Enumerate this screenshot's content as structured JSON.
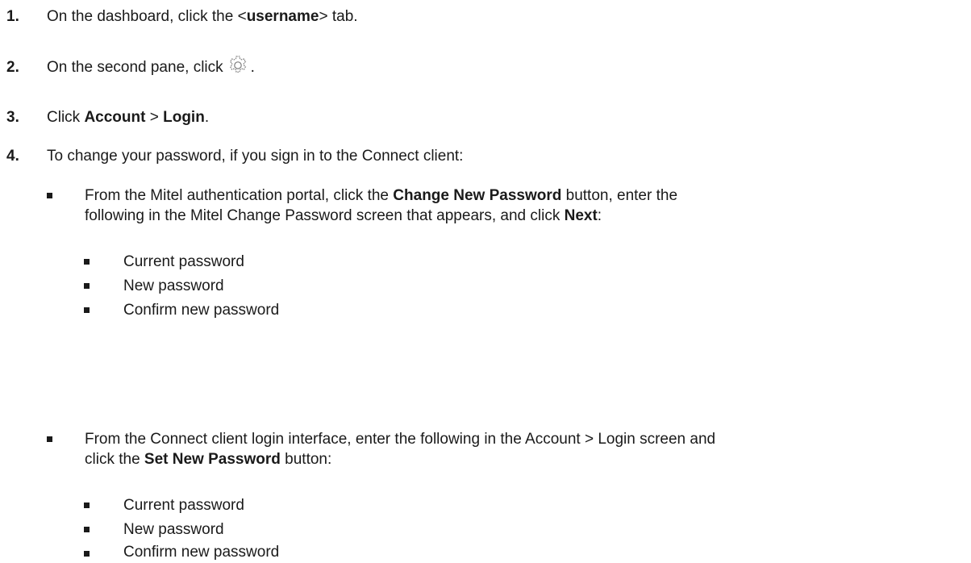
{
  "steps": [
    {
      "num": "1.",
      "pre": "On the dashboard, click the <",
      "bold": "username",
      "post": "> tab."
    },
    {
      "num": "2.",
      "pre": "On the second pane, click",
      "post": "."
    },
    {
      "num": "3.",
      "pre": "Click ",
      "bold1": "Account",
      "mid": " > ",
      "bold2": "Login",
      "post": "."
    },
    {
      "num": "4.",
      "text": "To change your password, if you sign in to the Connect client:"
    }
  ],
  "option_portal": {
    "pre": "From the Mitel authentication portal, click the ",
    "bold": "Change New Password",
    "post": " button, enter the",
    "line2_pre": "following in the Mitel Change Password screen that appears, and click ",
    "line2_bold": "Next",
    "line2_post": ":",
    "items": [
      "Current password",
      "New password",
      "Confirm new password"
    ]
  },
  "option_client": {
    "line1": "From the Connect client login interface, enter the following in the Account > Login screen and",
    "line2_pre": "click the ",
    "line2_bold": "Set New Password",
    "line2_post": " button:",
    "items": [
      "Current password",
      "New password",
      "Confirm new password"
    ]
  },
  "icons": {
    "settings": "gear-icon",
    "bullet": "square-bullet-icon"
  },
  "colors": {
    "text": "#1a1a1a",
    "icon": "#7a7a7a"
  }
}
